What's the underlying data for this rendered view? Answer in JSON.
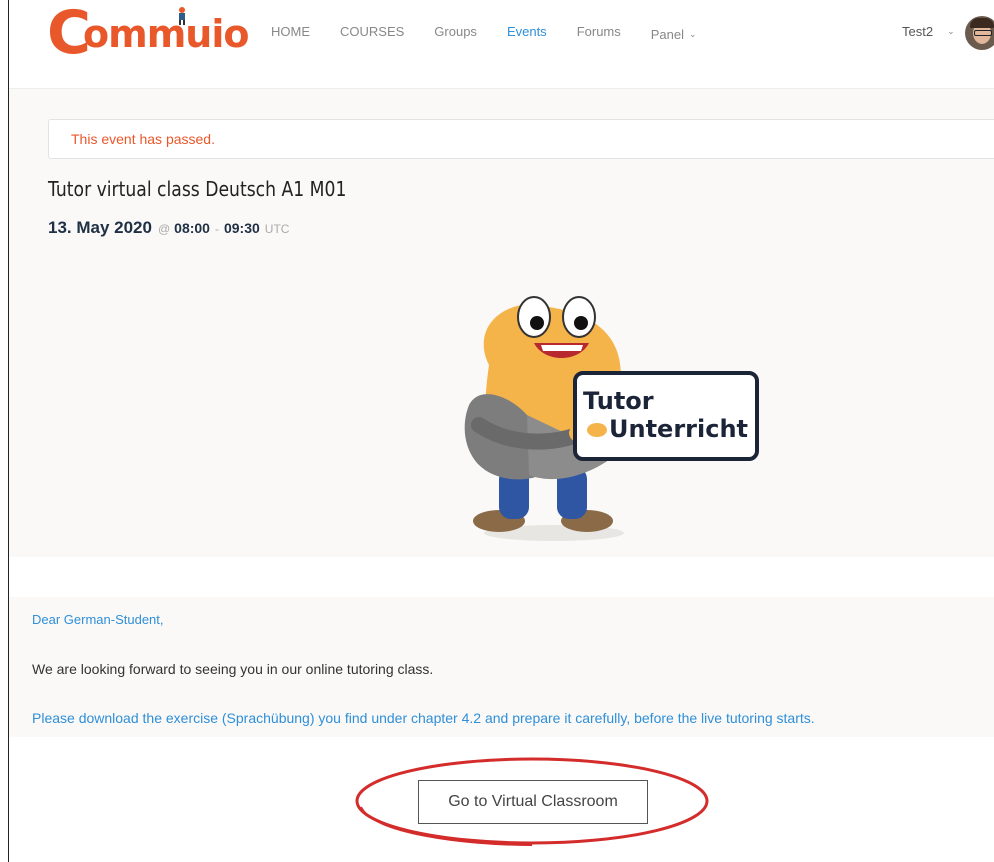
{
  "header": {
    "logo_text": "Commuio",
    "nav": [
      {
        "label": "HOME"
      },
      {
        "label": "COURSES"
      },
      {
        "label": "Groups"
      },
      {
        "label": "Events"
      },
      {
        "label": "Forums"
      },
      {
        "label": "Panel"
      }
    ],
    "active_nav": "Events",
    "user": {
      "name": "Test2"
    }
  },
  "event": {
    "notice": "This event has passed.",
    "title": "Tutor virtual class Deutsch A1 M01",
    "date": "13. May 2020",
    "at": "@",
    "start": "08:00",
    "sep": "-",
    "end": "09:30",
    "timezone": "UTC",
    "image": {
      "line1": "Tutor",
      "line2": "Unterricht"
    }
  },
  "description": {
    "greeting": "Dear German-Student,",
    "line1": "We are looking forward to seeing you in our online tutoring class.",
    "line2": "Please download the exercise (Sprachübung) you find under chapter 4.2 and prepare it carefully, before the live tutoring starts."
  },
  "cta": {
    "label": "Go to Virtual Classroom"
  },
  "colors": {
    "brand": "#e8582b",
    "link": "#2f8fd8",
    "annotation": "#d42b2b",
    "section_bg": "#faf9f7"
  },
  "icons": {
    "nav_panel": "chevron-down-icon",
    "user_menu": "chevron-down-icon"
  }
}
